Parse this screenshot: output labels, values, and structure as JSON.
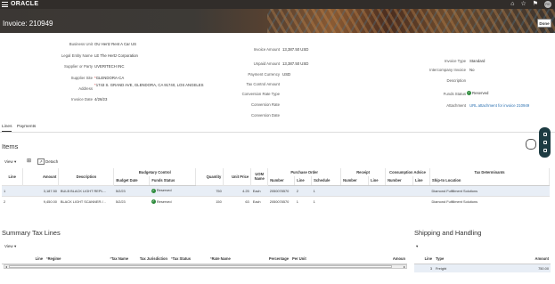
{
  "topbar": {
    "logo": "ORACLE",
    "avatar": "RG"
  },
  "header": {
    "title": "Invoice: 210949",
    "done_label": "Done"
  },
  "summary": {
    "col1": [
      {
        "label": "Business Unit",
        "value": "OU Hertz Rent A Car US"
      },
      {
        "label": "Legal Entity Name",
        "value": "LE The Hertz Corporation"
      },
      {
        "label": "Supplier or Party",
        "value": "UVERITECH INC"
      },
      {
        "label": "Supplier Site",
        "value": "GLENDORA-CA"
      },
      {
        "label": "Address",
        "value": "1743 S. GRAND AVE, GLENDORA, CA 91740, LOS ANGELES"
      },
      {
        "label": "Invoice Date",
        "value": "4/26/23"
      }
    ],
    "col2": [
      {
        "label": "Invoice Amount",
        "value": "13,387.50  USD"
      },
      {
        "label": "Unpaid Amount",
        "value": "13,387.50  USD"
      },
      {
        "label": "Payment Currency",
        "value": "USD"
      },
      {
        "label": "Tax Control Amount",
        "value": ""
      },
      {
        "label": "Conversion Rate Type",
        "value": ""
      },
      {
        "label": "Conversion Rate",
        "value": ""
      },
      {
        "label": "Conversion Date",
        "value": ""
      }
    ],
    "col3": [
      {
        "label": "Invoice Type",
        "value": "Standard"
      },
      {
        "label": "Intercompany Invoice",
        "value": "No"
      },
      {
        "label": "Description",
        "value": ""
      },
      {
        "label": "Funds Status",
        "value": "Reserved"
      },
      {
        "label": "Attachment",
        "value": "URL attachment for invoice 210949"
      }
    ]
  },
  "tabs": [
    "Lines",
    "Payments"
  ],
  "items": {
    "title": "Items",
    "view_label": "View",
    "detach_label": "Detach",
    "group_headers": [
      "Budgetary Control",
      "Purchase Order",
      "Receipt",
      "Consumption Advice",
      "Tax Determinants"
    ],
    "columns": [
      "Line",
      "Amount",
      "Description",
      "Budget Date",
      "Funds Status",
      "Quantity",
      "Unit Price",
      "UOM Name",
      "Number",
      "Line",
      "Schedule",
      "Number",
      "Line",
      "Number",
      "Line",
      "Ship-to Location"
    ],
    "rows": [
      [
        "1",
        "3,187.50",
        "BULB BLACK LIGHT REPL...",
        "5/2/23",
        "Reserved",
        "750",
        "4.25",
        "Each",
        "2050078570",
        "2",
        "1",
        "",
        "",
        "",
        "",
        "Diamond Fulfillment Solutions"
      ],
      [
        "2",
        "9,450.00",
        "BLACK LIGHT SCANNER /...",
        "5/2/23",
        "Reserved",
        "150",
        "63",
        "Each",
        "2050078570",
        "1",
        "1",
        "",
        "",
        "",
        "",
        "Diamond Fulfillment Solutions"
      ]
    ]
  },
  "tax_lines": {
    "title": "Summary Tax Lines",
    "view_label": "View",
    "columns": [
      "Line",
      "Regime",
      "Tax Name",
      "Tax Jurisdiction",
      "Tax Status",
      "Rate Name",
      "Percentage",
      "Per Unit",
      "Amoun"
    ]
  },
  "shipping": {
    "title": "Shipping and Handling",
    "columns": [
      "Line",
      "Type",
      "Amount"
    ],
    "rows": [
      [
        "3",
        "Freight",
        "750.00"
      ]
    ]
  }
}
